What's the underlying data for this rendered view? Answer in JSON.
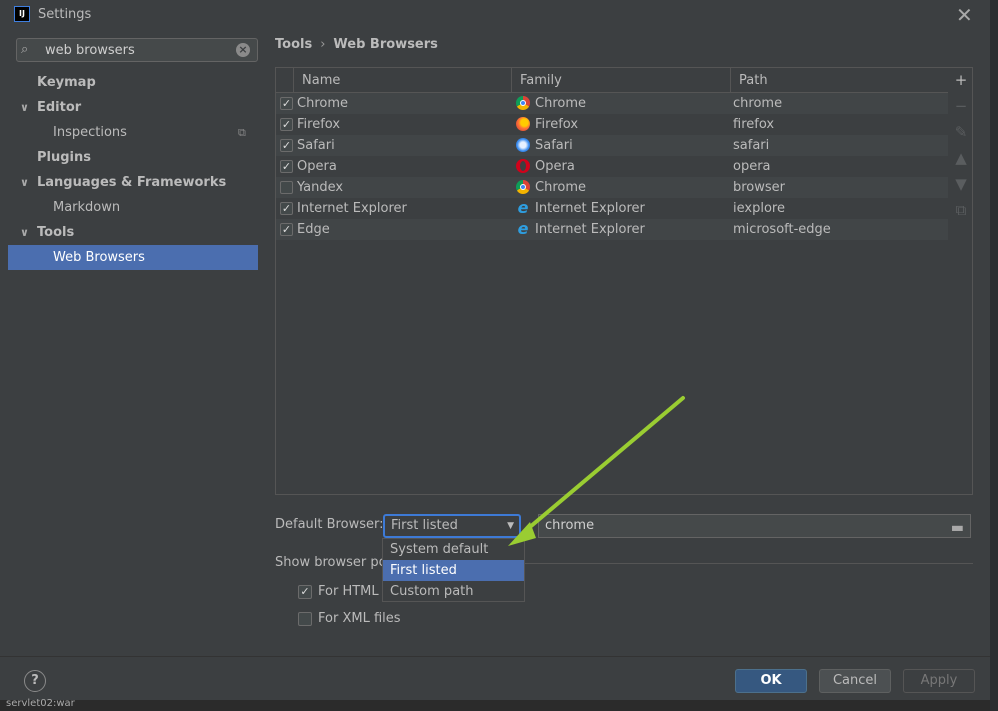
{
  "window": {
    "title": "Settings",
    "app_icon_text": "IJ"
  },
  "sidebar": {
    "search": {
      "value": "web browsers",
      "placeholder": ""
    },
    "items": [
      {
        "label": "Keymap",
        "level": 0,
        "expanded": null,
        "selected": false
      },
      {
        "label": "Editor",
        "level": 0,
        "expanded": true,
        "selected": false
      },
      {
        "label": "Inspections",
        "level": 1,
        "selected": false
      },
      {
        "label": "Plugins",
        "level": 0,
        "expanded": null,
        "selected": false
      },
      {
        "label": "Languages & Frameworks",
        "level": 0,
        "expanded": true,
        "selected": false
      },
      {
        "label": "Markdown",
        "level": 1,
        "selected": false
      },
      {
        "label": "Tools",
        "level": 0,
        "expanded": true,
        "selected": false
      },
      {
        "label": "Web Browsers",
        "level": 1,
        "selected": true
      }
    ]
  },
  "breadcrumb": {
    "parent": "Tools",
    "current": "Web Browsers",
    "separator": "›"
  },
  "table": {
    "headers": [
      "Name",
      "Family",
      "Path"
    ],
    "rows": [
      {
        "checked": true,
        "name": "Chrome",
        "family": "Chrome",
        "family_icon": "chrome",
        "path": "chrome"
      },
      {
        "checked": true,
        "name": "Firefox",
        "family": "Firefox",
        "family_icon": "firefox",
        "path": "firefox"
      },
      {
        "checked": true,
        "name": "Safari",
        "family": "Safari",
        "family_icon": "safari",
        "path": "safari"
      },
      {
        "checked": true,
        "name": "Opera",
        "family": "Opera",
        "family_icon": "opera",
        "path": "opera"
      },
      {
        "checked": false,
        "name": "Yandex",
        "family": "Chrome",
        "family_icon": "chrome",
        "path": "browser"
      },
      {
        "checked": true,
        "name": "Internet Explorer",
        "family": "Internet Explorer",
        "family_icon": "ie",
        "path": "iexplore"
      },
      {
        "checked": true,
        "name": "Edge",
        "family": "Internet Explorer",
        "family_icon": "ie",
        "path": "microsoft-edge"
      }
    ],
    "tools": [
      "add-icon",
      "remove-icon",
      "edit-icon",
      "move-up-icon",
      "move-down-icon",
      "copy-icon"
    ]
  },
  "default_browser": {
    "label": "Default Browser:",
    "selected": "First listed",
    "path": "chrome",
    "options": [
      "System default",
      "First listed",
      "Custom path"
    ]
  },
  "popup_section": {
    "label": "Show browser pop",
    "html_files_label": "For HTML f",
    "html_files_checked": true,
    "xml_files_label": "For XML files",
    "xml_files_checked": false
  },
  "buttons": {
    "ok": "OK",
    "cancel": "Cancel",
    "apply": "Apply",
    "help": "?"
  },
  "taskbar": {
    "item": "servlet02:war"
  },
  "colors": {
    "accent": "#4b6eaf",
    "ok_button": "#365880",
    "arrow": "#9acd32"
  }
}
